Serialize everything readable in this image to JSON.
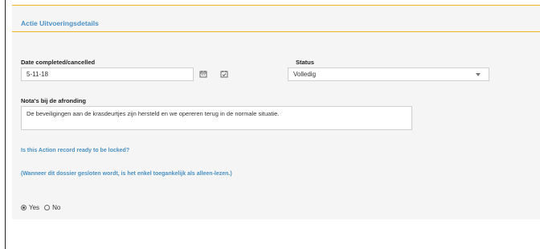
{
  "section": {
    "title": "Actie Uitvoeringsdetails"
  },
  "date_field": {
    "label": "Date completed/cancelled",
    "value": "5-11-18"
  },
  "status_field": {
    "label": "Status",
    "value": "Volledig"
  },
  "notes_field": {
    "label": "Nota's bij de afronding",
    "value": "De beveiligingen aan de krasdeurtjes zijn hersteld en we opereren terug in de normale situatie."
  },
  "lock": {
    "question": "Is this Action record ready to be locked?",
    "note": "(Wanneer dit dossier gesloten wordt, is het enkel toegankelijk als alleen-lezen.)",
    "options": [
      {
        "label": "Yes",
        "selected": true
      },
      {
        "label": "No",
        "selected": false
      }
    ]
  },
  "icons": {
    "calendar": "calendar-icon",
    "calendar_check": "calendar-check-icon"
  },
  "colors": {
    "accent": "#f0b323",
    "link": "#4a90c2"
  }
}
